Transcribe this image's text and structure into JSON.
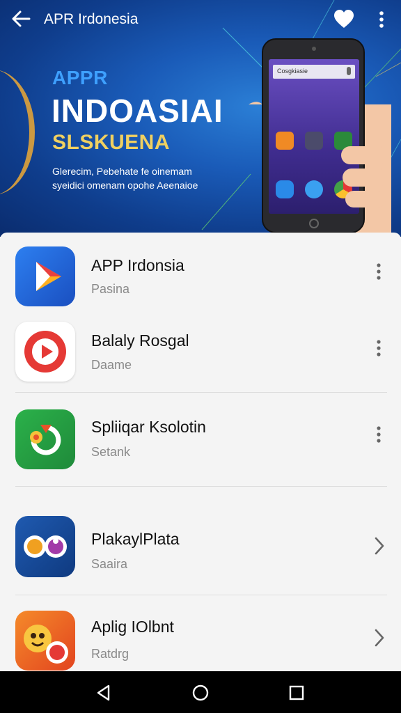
{
  "topbar": {
    "title": "APR Irdonesia",
    "back_icon": "arrow-left-icon",
    "favorite_icon": "heart-icon",
    "menu_icon": "more-vertical-icon"
  },
  "banner": {
    "line1": "APPR",
    "line2": "INDOASIAI",
    "line3": "SLSKUENA",
    "desc1": "Glerecim, Pebehate fe oinemam",
    "desc2": "syeidici omenam opohe Aeenaioe",
    "phone_search": "Cosgkiasie"
  },
  "apps": [
    {
      "title": "APP Irdonsia",
      "subtitle": "Pasina",
      "action_icon": "more-vertical-icon"
    },
    {
      "title": "Balaly Rosgal",
      "subtitle": "Daame",
      "action_icon": "more-vertical-icon"
    },
    {
      "title": "Spliiqar Ksolotin",
      "subtitle": "Setank",
      "action_icon": "more-vertical-icon"
    },
    {
      "title": "PlakaylPlata",
      "subtitle": "Saaira",
      "action_icon": "chevron-right-icon"
    },
    {
      "title": "Aplig IOlbnt",
      "subtitle": "Ratdrg",
      "action_icon": "chevron-right-icon"
    }
  ],
  "navbar": {
    "back_icon": "triangle-back-icon",
    "home_icon": "circle-home-icon",
    "recents_icon": "square-recents-icon"
  },
  "colors": {
    "banner_dark": "#0f3d8c",
    "banner_light": "#2b7fd6",
    "accent_yellow": "#f0d060",
    "accent_blue": "#3ea0ff"
  }
}
